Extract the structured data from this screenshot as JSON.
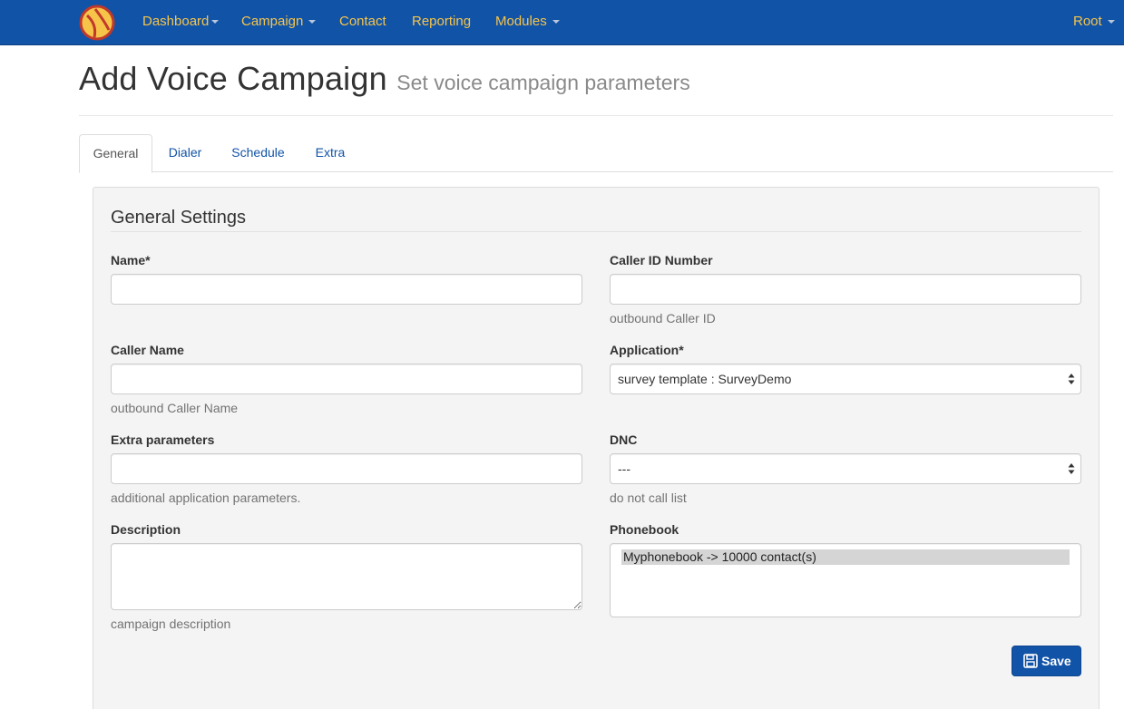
{
  "navbar": {
    "brand_icon": "logo-icon",
    "items": [
      {
        "label": "Dashboard",
        "dropdown": true
      },
      {
        "label": "Campaign",
        "dropdown": true
      },
      {
        "label": "Contact",
        "dropdown": false
      },
      {
        "label": "Reporting",
        "dropdown": false
      },
      {
        "label": "Modules",
        "dropdown": true
      }
    ],
    "user": {
      "label": "Root",
      "dropdown": true
    },
    "colors": {
      "background": "#1153a6",
      "link": "#f7c44a"
    }
  },
  "header": {
    "title": "Add Voice Campaign",
    "subtitle": "Set voice campaign parameters"
  },
  "tabs": [
    {
      "label": "General",
      "active": true
    },
    {
      "label": "Dialer",
      "active": false
    },
    {
      "label": "Schedule",
      "active": false
    },
    {
      "label": "Extra",
      "active": false
    }
  ],
  "form": {
    "legend": "General Settings",
    "name": {
      "label": "Name*",
      "value": "",
      "placeholder": ""
    },
    "caller_id_number": {
      "label": "Caller ID Number",
      "value": "",
      "help": "outbound Caller ID"
    },
    "caller_name": {
      "label": "Caller Name",
      "value": "",
      "help": "outbound Caller Name"
    },
    "application": {
      "label": "Application*",
      "selected": "survey template : SurveyDemo"
    },
    "extra_parameters": {
      "label": "Extra parameters",
      "value": "",
      "help": "additional application parameters."
    },
    "dnc": {
      "label": "DNC",
      "selected": "---",
      "help": "do not call list"
    },
    "description": {
      "label": "Description",
      "value": "",
      "help": "campaign description"
    },
    "phonebook": {
      "label": "Phonebook",
      "options": [
        "Myphonebook -> 10000 contact(s)"
      ]
    },
    "save_label": "Save",
    "save_icon": "floppy-disk-icon"
  }
}
